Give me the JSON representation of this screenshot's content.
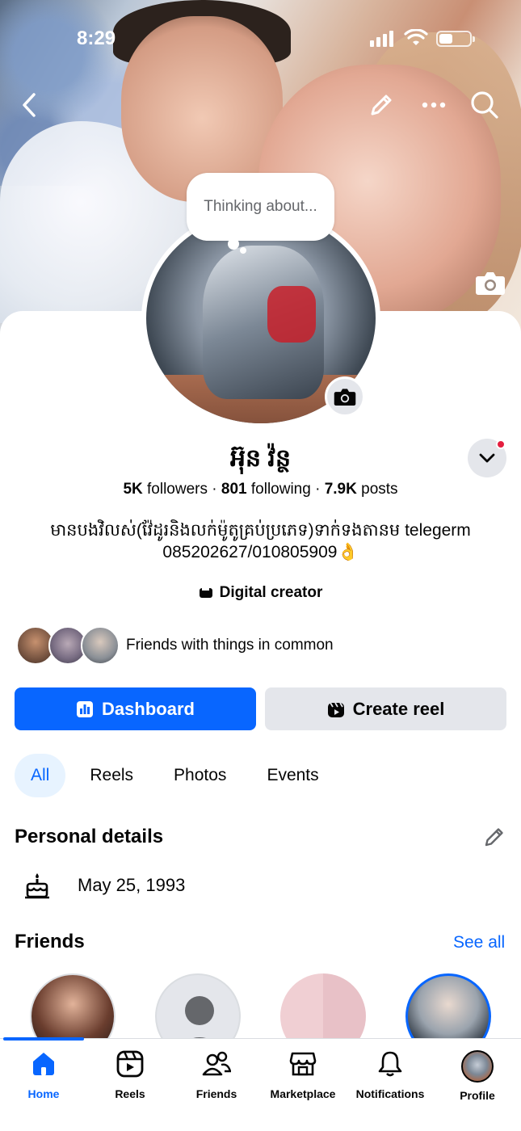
{
  "status_bar": {
    "time": "8:29"
  },
  "top_bar": {
    "back_icon": "chevron-left-icon",
    "edit_icon": "pencil-icon",
    "more_icon": "more-dots-icon",
    "search_icon": "search-icon"
  },
  "avatar_bubble": {
    "placeholder": "Thinking about..."
  },
  "profile": {
    "name": "អ៊ុន វ៉ន្ថ",
    "followers": "5K",
    "followers_label": "followers",
    "following": "801",
    "following_label": "following",
    "posts": "7.9K",
    "posts_label": "posts",
    "bio": "មានបងវិលស់(វ៉ែដូរនិងលក់ម៉ូតូគ្រប់ប្រភេទ)ទាក់ទងតានម telegerm 085202627/010805909👌",
    "category": "Digital creator",
    "mutual_text": "Friends with things in common"
  },
  "actions": {
    "dashboard_label": "Dashboard",
    "create_reel_label": "Create reel"
  },
  "tabs": [
    {
      "label": "All",
      "active": true
    },
    {
      "label": "Reels",
      "active": false
    },
    {
      "label": "Photos",
      "active": false
    },
    {
      "label": "Events",
      "active": false
    }
  ],
  "personal_details": {
    "title": "Personal details",
    "birthday": "May 25, 1993"
  },
  "friends": {
    "title": "Friends",
    "see_all": "See all"
  },
  "bottom_nav": [
    {
      "label": "Home",
      "icon": "home-icon",
      "active": true
    },
    {
      "label": "Reels",
      "icon": "reels-icon",
      "active": false
    },
    {
      "label": "Friends",
      "icon": "friends-icon",
      "active": false
    },
    {
      "label": "Marketplace",
      "icon": "marketplace-icon",
      "active": false
    },
    {
      "label": "Notifications",
      "icon": "bell-icon",
      "active": false
    },
    {
      "label": "Profile",
      "icon": "profile-avatar",
      "active": false
    }
  ],
  "colors": {
    "accent": "#0866ff",
    "secondary_btn": "#e4e6eb",
    "tab_active_bg": "#e7f3ff",
    "notification_dot": "#e41e3f"
  }
}
